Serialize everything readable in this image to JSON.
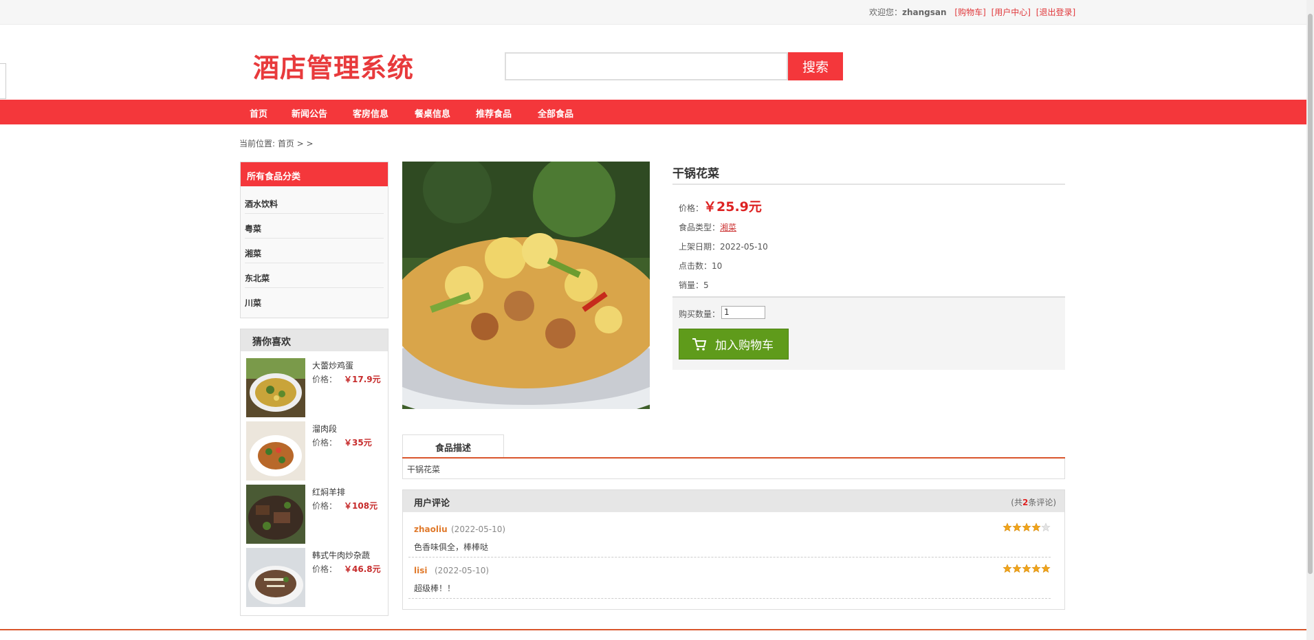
{
  "topbar": {
    "welcome": "欢迎您：",
    "username": "zhangsan",
    "cart_link": "[购物车]",
    "user_center_link": "[用户中心]",
    "logout_link": "[退出登录]"
  },
  "header": {
    "logo": "酒店管理系统",
    "search_placeholder": "",
    "search_button": "搜索"
  },
  "nav": [
    "首页",
    "新闻公告",
    "客房信息",
    "餐桌信息",
    "推荐食品",
    "全部食品"
  ],
  "breadcrumb": "当前位置: 首页 >  >",
  "categories": {
    "title": "所有食品分类",
    "items": [
      "酒水饮料",
      "粤菜",
      "湘菜",
      "东北菜",
      "川菜"
    ]
  },
  "recommend": {
    "title": "猜你喜欢",
    "price_label": "价格：",
    "items": [
      {
        "name": "大蕾炒鸡蛋",
        "price": "￥17.9元"
      },
      {
        "name": "溜肉段",
        "price": "￥35元"
      },
      {
        "name": "红焖羊排",
        "price": "￥108元"
      },
      {
        "name": "韩式牛肉炒杂蔬",
        "price": "￥46.8元"
      }
    ]
  },
  "product": {
    "name": "干锅花菜",
    "price_label": "价格：",
    "price": "￥25.9元",
    "type_label": "食品类型：",
    "type": "湘菜",
    "date_label": "上架日期：",
    "date": "2022-05-10",
    "clicks_label": "点击数：",
    "clicks": "10",
    "sales_label": "销量：",
    "sales": "5",
    "qty_label": "购买数量：",
    "qty": "1",
    "cart_button": "加入购物车"
  },
  "description": {
    "tab": "食品描述",
    "text": "干锅花菜"
  },
  "comments": {
    "title": "用户评论",
    "count_prefix": "(共",
    "count": "2",
    "count_suffix": "条评论)",
    "items": [
      {
        "user": "zhaoliu",
        "date": "(2022-05-10)",
        "text": "色香味俱全，棒棒哒",
        "rating": 4
      },
      {
        "user": "lisi",
        "date": "(2022-05-10)",
        "text": "超级棒！！",
        "rating": 5
      }
    ]
  },
  "colors": {
    "brand_red": "#f4373b",
    "cart_green": "#5f9b1b",
    "accent_orange": "#d9552b"
  }
}
